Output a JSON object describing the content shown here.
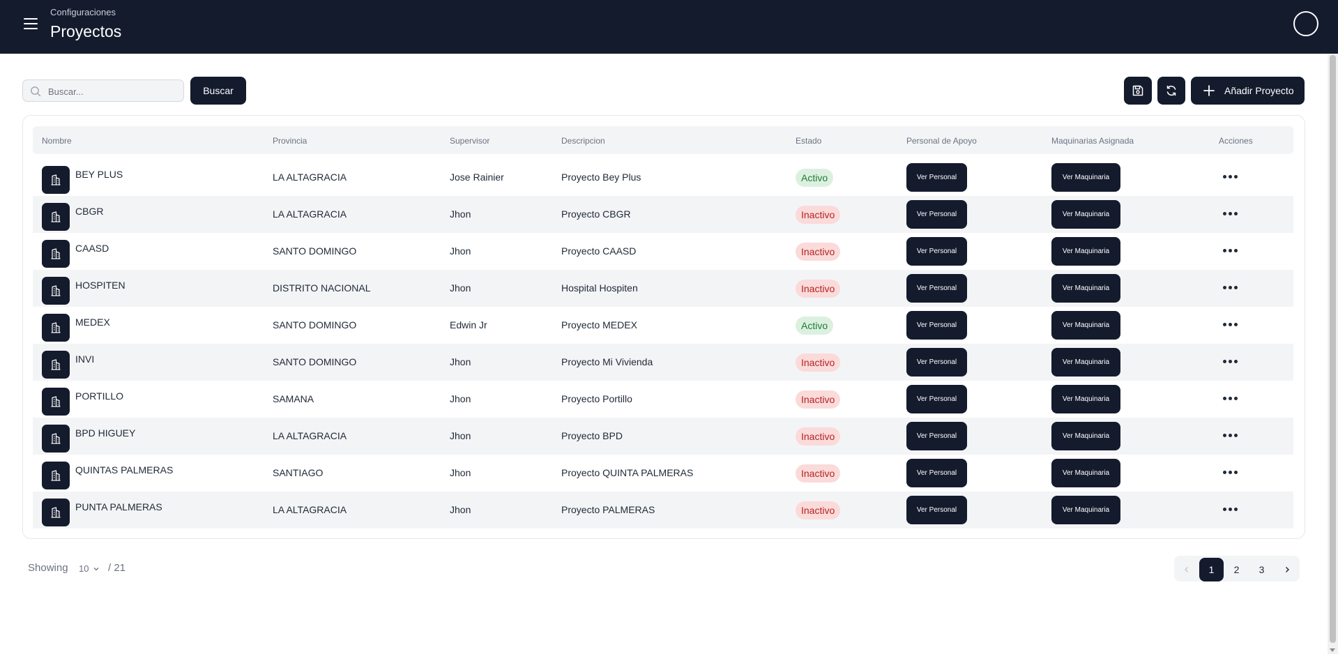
{
  "header": {
    "breadcrumb": "Configuraciones",
    "title": "Proyectos",
    "menu_icon": "hamburger-menu-icon",
    "avatar_icon": "user-avatar-icon"
  },
  "toolbar": {
    "search_placeholder": "Buscar...",
    "search_value": "",
    "search_button": "Buscar",
    "save_icon": "save-icon",
    "refresh_icon": "refresh-icon",
    "add_label": "Añadir Proyecto"
  },
  "table": {
    "columns": [
      "Nombre",
      "Provincia",
      "Supervisor",
      "Descripcion",
      "Estado",
      "Personal de Apoyo",
      "Maquinarias Asignada",
      "Acciones"
    ],
    "personal_button": "Ver Personal",
    "maquinaria_button": "Ver Maquinaria",
    "rows": [
      {
        "nombre": "BEY PLUS",
        "provincia": "LA ALTAGRACIA",
        "supervisor": "Jose Rainier",
        "descripcion": "Proyecto Bey Plus",
        "estado": "Activo"
      },
      {
        "nombre": "CBGR",
        "provincia": "LA ALTAGRACIA",
        "supervisor": "Jhon",
        "descripcion": "Proyecto CBGR",
        "estado": "Inactivo"
      },
      {
        "nombre": "CAASD",
        "provincia": "SANTO DOMINGO",
        "supervisor": "Jhon",
        "descripcion": "Proyecto CAASD",
        "estado": "Inactivo"
      },
      {
        "nombre": "HOSPITEN",
        "provincia": "DISTRITO NACIONAL",
        "supervisor": "Jhon",
        "descripcion": "Hospital Hospiten",
        "estado": "Inactivo"
      },
      {
        "nombre": "MEDEX",
        "provincia": "SANTO DOMINGO",
        "supervisor": "Edwin Jr",
        "descripcion": "Proyecto MEDEX",
        "estado": "Activo"
      },
      {
        "nombre": "INVI",
        "provincia": "SANTO DOMINGO",
        "supervisor": "Jhon",
        "descripcion": "Proyecto Mi Vivienda",
        "estado": "Inactivo"
      },
      {
        "nombre": "PORTILLO",
        "provincia": "SAMANA",
        "supervisor": "Jhon",
        "descripcion": "Proyecto Portillo",
        "estado": "Inactivo"
      },
      {
        "nombre": "BPD HIGUEY",
        "provincia": "LA ALTAGRACIA",
        "supervisor": "Jhon",
        "descripcion": "Proyecto BPD",
        "estado": "Inactivo"
      },
      {
        "nombre": "QUINTAS PALMERAS",
        "provincia": "SANTIAGO",
        "supervisor": "Jhon",
        "descripcion": "Proyecto QUINTA PALMERAS",
        "estado": "Inactivo"
      },
      {
        "nombre": "PUNTA PALMERAS",
        "provincia": "LA ALTAGRACIA",
        "supervisor": "Jhon",
        "descripcion": "Proyecto PALMERAS",
        "estado": "Inactivo"
      }
    ]
  },
  "footer": {
    "showing_label": "Showing",
    "page_size": "10",
    "total": "/ 21",
    "pages": [
      "1",
      "2",
      "3"
    ],
    "current_page": "1"
  },
  "colors": {
    "primary": "#141b2d",
    "active_bg": "#dcf0e0",
    "active_text": "#1f7a36",
    "inactive_bg": "#fbdada",
    "inactive_text": "#b42323"
  }
}
